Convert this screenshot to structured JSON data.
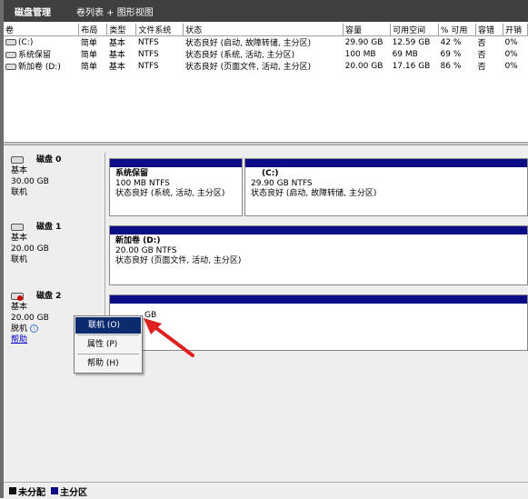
{
  "window": {
    "title": "磁盘管理",
    "view_mode": "卷列表 + 图形视图"
  },
  "columns": [
    "卷",
    "布局",
    "类型",
    "文件系统",
    "状态",
    "容量",
    "可用空间",
    "% 可用",
    "容错",
    "开销"
  ],
  "volumes": [
    {
      "name": "(C:)",
      "layout": "简单",
      "type": "基本",
      "fs": "NTFS",
      "status": "状态良好 (启动, 故障转储, 主分区)",
      "capacity": "29.90 GB",
      "free": "12.59 GB",
      "pct": "42 %",
      "ft": "否",
      "overhead": "0%"
    },
    {
      "name": "系统保留",
      "layout": "简单",
      "type": "基本",
      "fs": "NTFS",
      "status": "状态良好 (系统, 活动, 主分区)",
      "capacity": "100 MB",
      "free": "69 MB",
      "pct": "69 %",
      "ft": "否",
      "overhead": "0%"
    },
    {
      "name": "新加卷 (D:)",
      "layout": "简单",
      "type": "基本",
      "fs": "NTFS",
      "status": "状态良好 (页面文件, 活动, 主分区)",
      "capacity": "20.00 GB",
      "free": "17.16 GB",
      "pct": "86 %",
      "ft": "否",
      "overhead": "0%"
    }
  ],
  "disks": [
    {
      "name": "磁盘 0",
      "type": "基本",
      "size": "30.00 GB",
      "status": "联机",
      "partitions": [
        {
          "name": "系统保留",
          "size_fs": "100 MB NTFS",
          "status": "状态良好 (系统, 活动, 主分区)"
        },
        {
          "name": "(C:)",
          "size_fs": "29.90 GB NTFS",
          "status": "状态良好 (启动, 故障转储, 主分区)"
        }
      ]
    },
    {
      "name": "磁盘 1",
      "type": "基本",
      "size": "20.00 GB",
      "status": "联机",
      "partitions": [
        {
          "name": "新加卷  (D:)",
          "size_fs": "20.00 GB NTFS",
          "status": "状态良好 (页面文件, 活动, 主分区)"
        }
      ]
    },
    {
      "name": "磁盘 2",
      "type": "基本",
      "size": "20.00 GB",
      "status": "脱机",
      "help_link": "帮助",
      "partitions": [
        {
          "name": "",
          "size_fs": "GB",
          "status": ""
        }
      ]
    }
  ],
  "context_menu": {
    "items": [
      "联机 (O)",
      "属性 (P)",
      "帮助 (H)"
    ],
    "selected": 0
  },
  "legend": [
    {
      "label": "未分配",
      "color": "#111111"
    },
    {
      "label": "主分区",
      "color": "#0c0c86"
    }
  ],
  "icons": {
    "drive": "drive-icon",
    "disk": "disk-icon",
    "offline_disk": "offline-disk-icon",
    "info": "info-icon",
    "arrow": "red-arrow-annotation"
  }
}
